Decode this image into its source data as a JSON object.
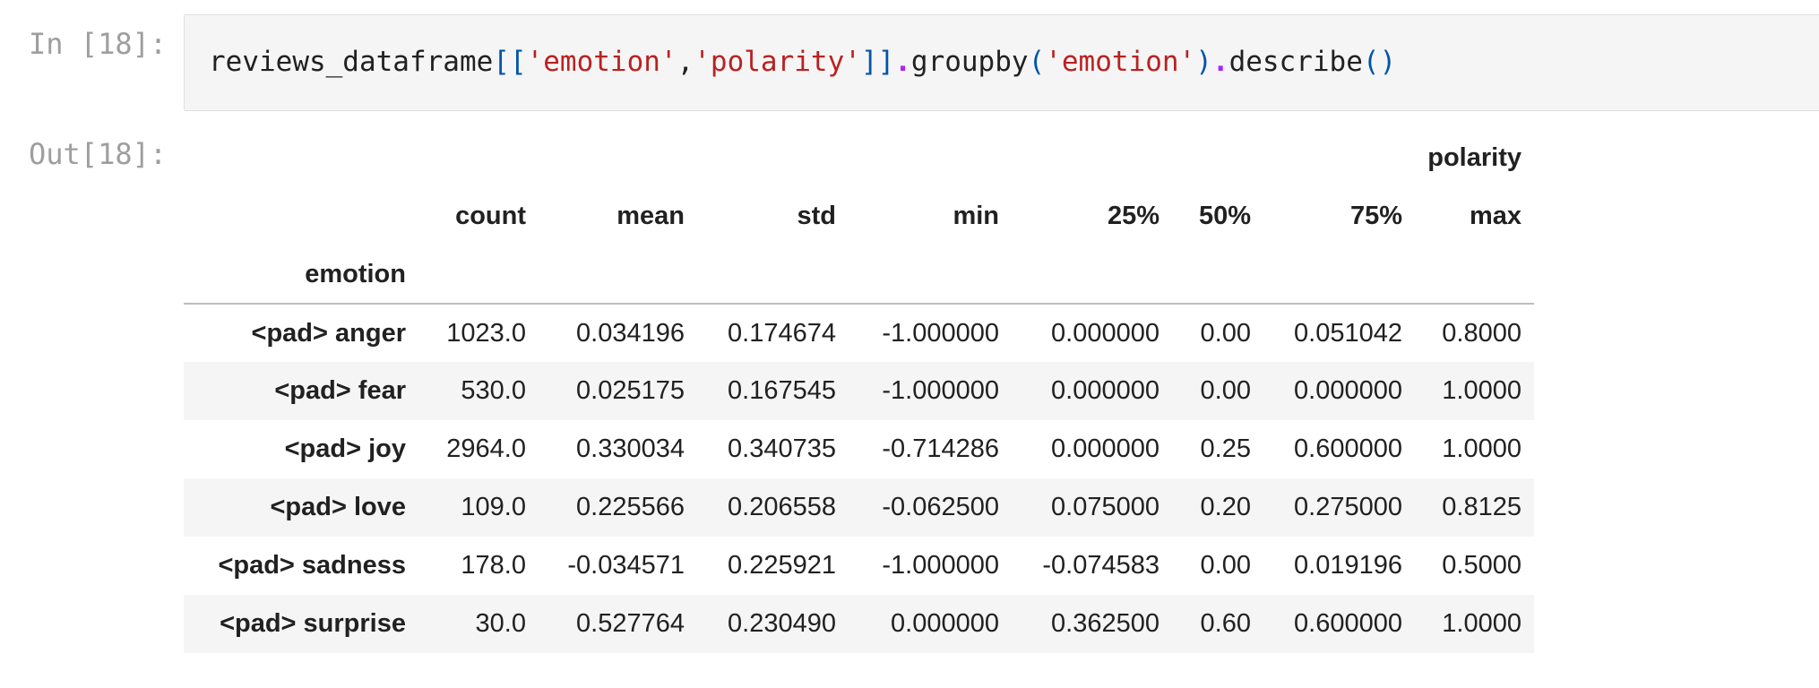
{
  "cell": {
    "in_prompt": "In [18]:",
    "out_prompt": "Out[18]:",
    "code": {
      "var": "reviews_dataframe",
      "open_brackets": "[[",
      "col1": "'emotion'",
      "comma": ",",
      "col2": "'polarity'",
      "close_brackets": "]]",
      "dot1": ".",
      "method1": "groupby",
      "paren_open1": "(",
      "arg1": "'emotion'",
      "paren_close1": ")",
      "dot2": ".",
      "method2": "describe",
      "parens2": "()"
    }
  },
  "table": {
    "top_header": "polarity",
    "columns": [
      "count",
      "mean",
      "std",
      "min",
      "25%",
      "50%",
      "75%",
      "max"
    ],
    "index_name": "emotion",
    "rows": [
      {
        "label": "<pad> anger",
        "values": [
          "1023.0",
          "0.034196",
          "0.174674",
          "-1.000000",
          "0.000000",
          "0.00",
          "0.051042",
          "0.8000"
        ]
      },
      {
        "label": "<pad> fear",
        "values": [
          "530.0",
          "0.025175",
          "0.167545",
          "-1.000000",
          "0.000000",
          "0.00",
          "0.000000",
          "1.0000"
        ]
      },
      {
        "label": "<pad> joy",
        "values": [
          "2964.0",
          "0.330034",
          "0.340735",
          "-0.714286",
          "0.000000",
          "0.25",
          "0.600000",
          "1.0000"
        ]
      },
      {
        "label": "<pad> love",
        "values": [
          "109.0",
          "0.225566",
          "0.206558",
          "-0.062500",
          "0.075000",
          "0.20",
          "0.275000",
          "0.8125"
        ]
      },
      {
        "label": "<pad> sadness",
        "values": [
          "178.0",
          "-0.034571",
          "0.225921",
          "-1.000000",
          "-0.074583",
          "0.00",
          "0.019196",
          "0.5000"
        ]
      },
      {
        "label": "<pad> surprise",
        "values": [
          "30.0",
          "0.527764",
          "0.230490",
          "0.000000",
          "0.362500",
          "0.60",
          "0.600000",
          "1.0000"
        ]
      }
    ]
  }
}
